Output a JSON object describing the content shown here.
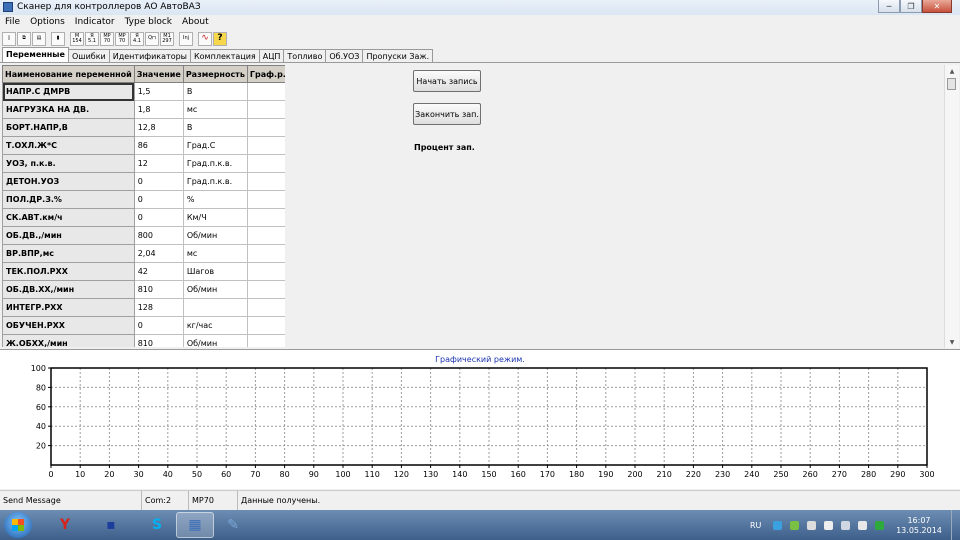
{
  "window": {
    "title": "Сканер для  контроллеров АО АвтоВАЗ",
    "min_glyph": "─",
    "max_glyph": "❐",
    "close_glyph": "✕"
  },
  "menu": [
    "File",
    "Options",
    "Indicator",
    "Type block",
    "About"
  ],
  "toolbar": [
    {
      "icon": "new-file-icon",
      "text": "▯"
    },
    {
      "icon": "copy-icon",
      "text": "⧉"
    },
    {
      "icon": "print-icon",
      "text": "▤"
    },
    {
      "icon": "memory-card-icon",
      "text": "▮"
    },
    {
      "icon": "block-m154-icon",
      "text": "M 154"
    },
    {
      "icon": "block-ya51-icon",
      "text": "Я 5.1"
    },
    {
      "icon": "block-mp70-icon",
      "text": "MP 70"
    },
    {
      "icon": "block-mp70-icon",
      "text": "MP 70"
    },
    {
      "icon": "block-ya41-icon",
      "text": "Я 4.1"
    },
    {
      "icon": "oscilloscope-icon",
      "text": "Q⊓"
    },
    {
      "icon": "block-m1-297-icon",
      "text": "M1 297"
    },
    {
      "icon": "injector-icon",
      "text": "Inj"
    },
    {
      "icon": "graph-icon",
      "text": "∿"
    },
    {
      "icon": "help-icon",
      "text": "?"
    }
  ],
  "tabs": [
    "Переменные",
    "Ошибки",
    "Идентификаторы",
    "Комплектация",
    "АЦП",
    "Топливо",
    "Об.УОЗ",
    "Пропуски Заж."
  ],
  "active_tab": 0,
  "table": {
    "headers": [
      "Наименование переменной",
      "Значение",
      "Размерность",
      "Граф.р."
    ],
    "rows": [
      {
        "name": "НАПР.С ДМРВ",
        "value": "1,5",
        "unit": "В",
        "graph": ""
      },
      {
        "name": "НАГРУЗКА НА ДВ.",
        "value": "1,8",
        "unit": "мс",
        "graph": ""
      },
      {
        "name": "БОРТ.НАПР,В",
        "value": "12,8",
        "unit": "В",
        "graph": ""
      },
      {
        "name": "Т.ОХЛ.Ж*С",
        "value": "86",
        "unit": "Град.С",
        "graph": ""
      },
      {
        "name": "УОЗ, п.к.в.",
        "value": "12",
        "unit": "Град.п.к.в.",
        "graph": ""
      },
      {
        "name": "ДЕТОН.УОЗ",
        "value": "0",
        "unit": "Град.п.к.в.",
        "graph": ""
      },
      {
        "name": "ПОЛ.ДР.З.%",
        "value": "0",
        "unit": "%",
        "graph": ""
      },
      {
        "name": "СК.АВТ.км/ч",
        "value": "0",
        "unit": "Км/Ч",
        "graph": ""
      },
      {
        "name": "ОБ.ДВ.,/мин",
        "value": "800",
        "unit": "Об/мин",
        "graph": ""
      },
      {
        "name": "ВР.ВПР,мс",
        "value": "2,04",
        "unit": "мс",
        "graph": ""
      },
      {
        "name": "ТЕК.ПОЛ.РХХ",
        "value": "42",
        "unit": "Шагов",
        "graph": ""
      },
      {
        "name": "ОБ.ДВ.ХХ,/мин",
        "value": "810",
        "unit": "Об/мин",
        "graph": ""
      },
      {
        "name": "ИНТЕГР.РХХ",
        "value": "128",
        "unit": "",
        "graph": ""
      },
      {
        "name": "ОБУЧЕН.РХХ",
        "value": "0",
        "unit": "кг/час",
        "graph": ""
      },
      {
        "name": "Ж.ОБХХ,/мин",
        "value": "810",
        "unit": "Об/мин",
        "graph": ""
      }
    ]
  },
  "buttons": {
    "start_record": "Начать запись",
    "stop_record": "Закончить зап."
  },
  "record_percent_label": "Процент зап.",
  "scroll_glyphs": {
    "up": "▲",
    "down": "▼"
  },
  "graph": {
    "title": "Графический режим.",
    "x_ticks": [
      "0",
      "10",
      "20",
      "30",
      "40",
      "50",
      "60",
      "70",
      "80",
      "90",
      "100",
      "110",
      "120",
      "130",
      "140",
      "150",
      "160",
      "170",
      "180",
      "190",
      "200",
      "210",
      "220",
      "230",
      "240",
      "250",
      "260",
      "270",
      "280",
      "290",
      "300"
    ],
    "y_ticks": [
      "100",
      "80",
      "60",
      "40",
      "20"
    ],
    "x_range": [
      0,
      300
    ],
    "y_range": [
      0,
      100
    ],
    "colors": {
      "grid": "#9c9c9c",
      "axis": "#000000",
      "title": "#1c35b0"
    }
  },
  "status": [
    "Send Message",
    "Com:2",
    "MP70",
    "Данные получены."
  ],
  "taskbar": {
    "apps": [
      {
        "icon": "yandex-browser-icon",
        "glyph": "Y",
        "color": "#d8231b"
      },
      {
        "icon": "save-disk-icon",
        "glyph": "▪",
        "color": "#1c3f9c"
      },
      {
        "icon": "skype-icon",
        "glyph": "S",
        "color": "#00aff0"
      },
      {
        "icon": "scanner-app-icon",
        "glyph": "▦",
        "color": "#3d6fb7"
      },
      {
        "icon": "paint-icon",
        "glyph": "✎",
        "color": "#7aa7d8"
      }
    ],
    "lang": "RU",
    "time": "16:07",
    "date": "13.05.2014"
  }
}
